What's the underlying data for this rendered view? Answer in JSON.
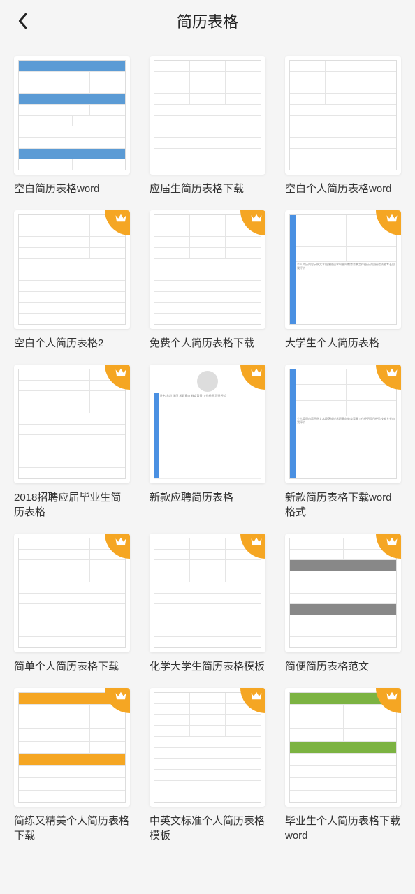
{
  "header": {
    "title": "简历表格"
  },
  "items": [
    {
      "title": "空白简历表格word",
      "premium": false,
      "style": "blue"
    },
    {
      "title": "应届生简历表格下载",
      "premium": false,
      "style": "plain"
    },
    {
      "title": "空白个人简历表格word",
      "premium": false,
      "style": "plain"
    },
    {
      "title": "空白个人简历表格2",
      "premium": true,
      "style": "plain"
    },
    {
      "title": "免费个人简历表格下载",
      "premium": true,
      "style": "plain"
    },
    {
      "title": "大学生个人简历表格",
      "premium": true,
      "style": "blue-side"
    },
    {
      "title": "2018招聘应届毕业生简历表格",
      "premium": true,
      "style": "plain"
    },
    {
      "title": "新款应聘简历表格",
      "premium": true,
      "style": "avatar"
    },
    {
      "title": "新款简历表格下载word格式",
      "premium": true,
      "style": "blue-side"
    },
    {
      "title": "简单个人简历表格下载",
      "premium": true,
      "style": "plain"
    },
    {
      "title": "化学大学生简历表格模板",
      "premium": true,
      "style": "plain"
    },
    {
      "title": "简便简历表格范文",
      "premium": true,
      "style": "grey"
    },
    {
      "title": "简练又精美个人简历表格下载",
      "premium": true,
      "style": "orange"
    },
    {
      "title": "中英文标准个人简历表格模板",
      "premium": true,
      "style": "plain"
    },
    {
      "title": "毕业生个人简历表格下载word",
      "premium": true,
      "style": "green"
    }
  ]
}
